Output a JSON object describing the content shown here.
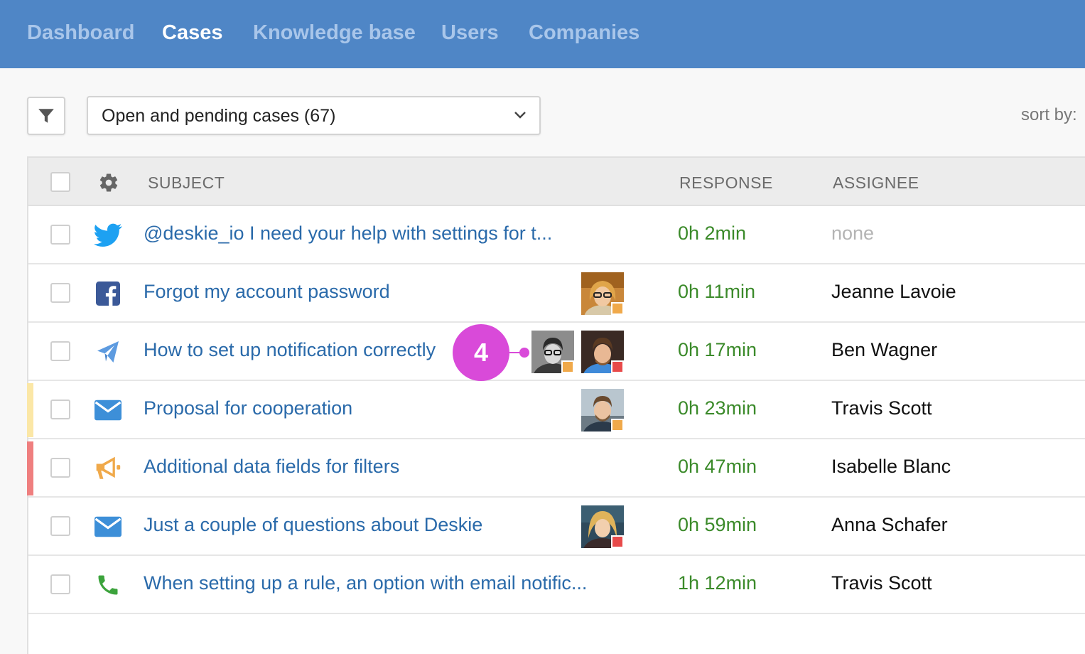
{
  "nav": {
    "items": [
      {
        "label": "Dashboard",
        "active": false
      },
      {
        "label": "Cases",
        "active": true
      },
      {
        "label": "Knowledge base",
        "active": false
      },
      {
        "label": "Users",
        "active": false
      },
      {
        "label": "Companies",
        "active": false
      }
    ]
  },
  "toolbar": {
    "filter_icon": "filter-icon",
    "view_select": "Open and pending cases (67)",
    "sort_label": "sort by:"
  },
  "table": {
    "headers": {
      "subject": "SUBJECT",
      "response": "RESPONSE",
      "assignee": "ASSIGNEE"
    },
    "rows": [
      {
        "channel": "twitter-icon",
        "subject": "@deskie_io I need your help with settings for t...",
        "response": "0h 2min",
        "assignee": "none",
        "priority": null,
        "avatars": []
      },
      {
        "channel": "facebook-icon",
        "subject": "Forgot my account password",
        "response": "0h 11min",
        "assignee": "Jeanne Lavoie",
        "priority": null,
        "avatars": [
          {
            "status": "#f0a94a"
          }
        ]
      },
      {
        "channel": "paper-plane-icon",
        "subject": "How to set up notification correctly",
        "response": "0h 17min",
        "assignee": "Ben Wagner",
        "priority": null,
        "avatars": [
          {
            "status": "#f0a94a"
          },
          {
            "status": "#e84a4a"
          }
        ]
      },
      {
        "channel": "envelope-icon",
        "subject": "Proposal for cooperation",
        "response": "0h 23min",
        "assignee": "Travis Scott",
        "priority": "#fbe7a6",
        "avatars": [
          {
            "status": "#f0a94a"
          }
        ]
      },
      {
        "channel": "megaphone-icon",
        "subject": "Additional data fields for filters",
        "response": "0h 47min",
        "assignee": "Isabelle Blanc",
        "priority": "#ef7f7f",
        "avatars": []
      },
      {
        "channel": "envelope-icon",
        "subject": "Just a couple of questions about Deskie",
        "response": "0h 59min",
        "assignee": "Anna Schafer",
        "priority": null,
        "avatars": [
          {
            "status": "#e84a4a"
          }
        ]
      },
      {
        "channel": "phone-icon",
        "subject": "When setting up a rule, an option with email notific...",
        "response": "1h 12min",
        "assignee": "Travis Scott",
        "priority": null,
        "avatars": []
      }
    ]
  },
  "annotation": {
    "badge": "4"
  },
  "colors": {
    "nav_bg": "#4f86c6",
    "link": "#2a6aaa",
    "response": "#3b8a2a",
    "badge": "#d94ad9",
    "twitter": "#1da1f2",
    "facebook": "#3b5998",
    "email": "#3d8fd8",
    "megaphone": "#f0a94a",
    "phone": "#3ca33c"
  }
}
